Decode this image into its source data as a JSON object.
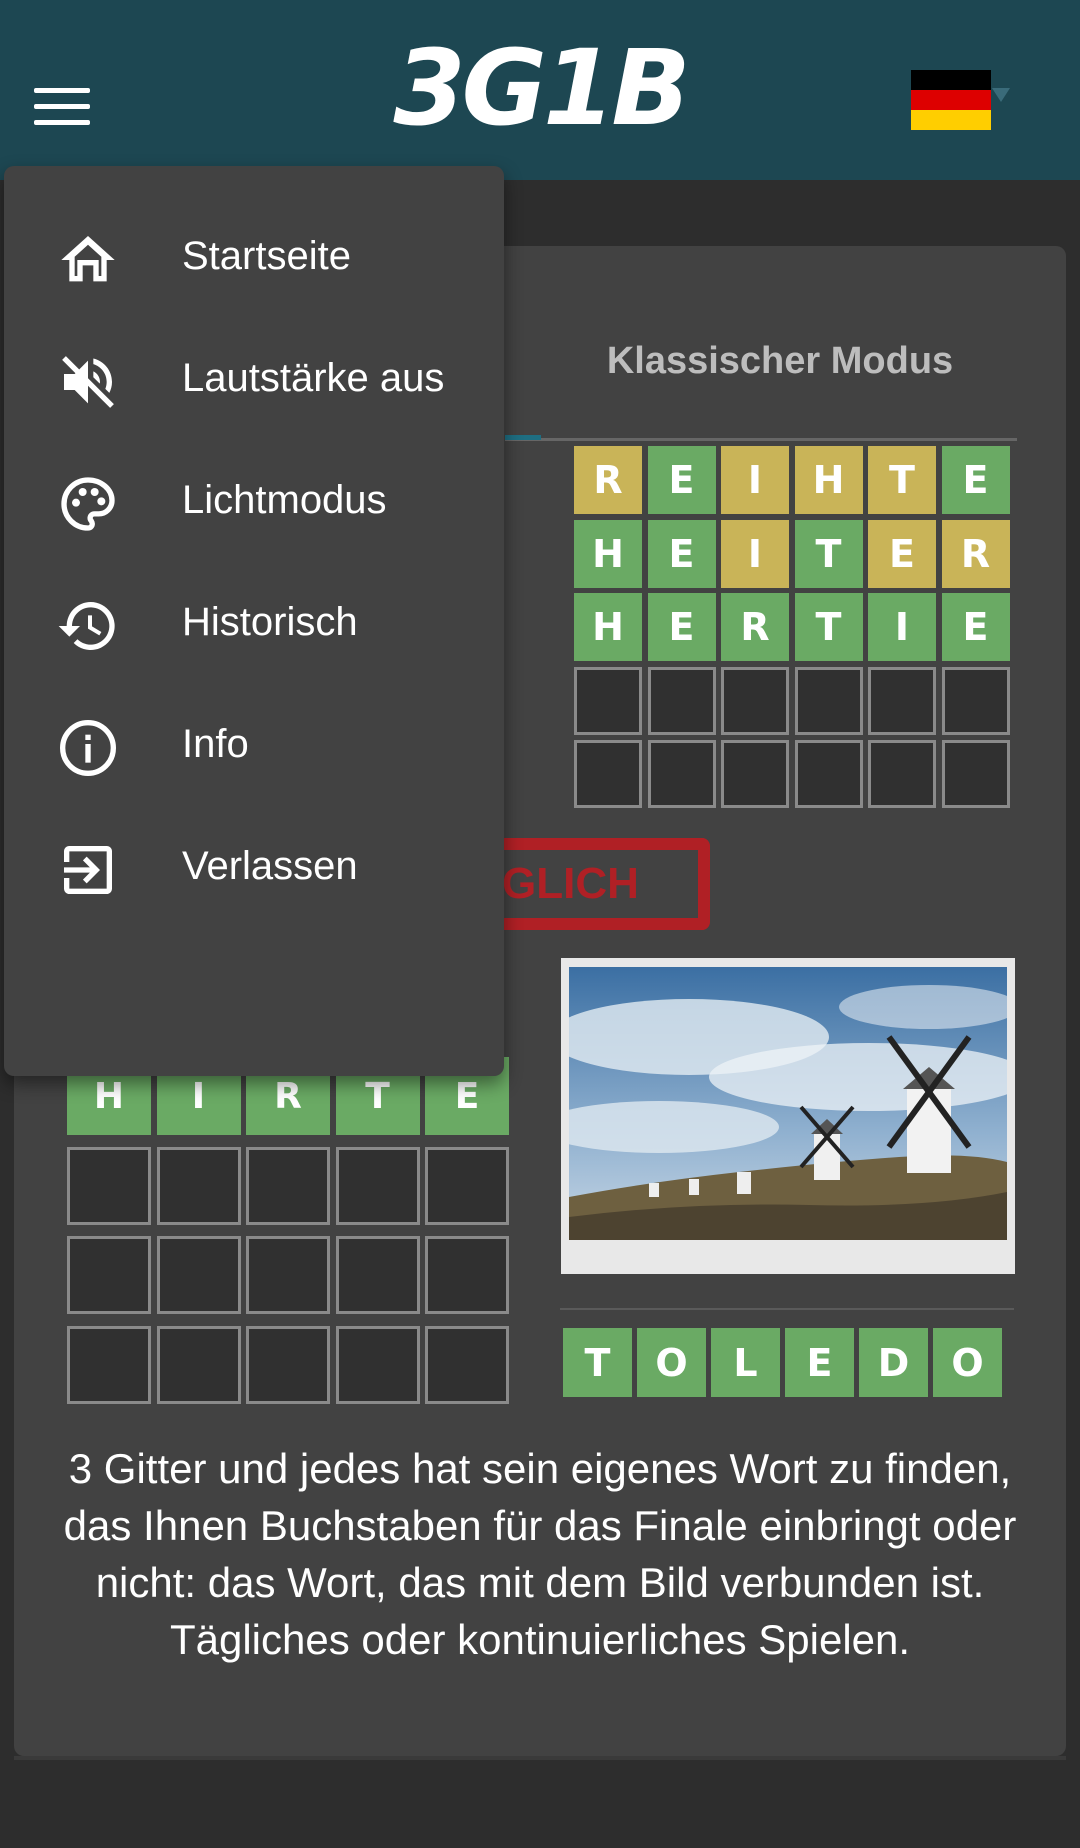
{
  "header": {
    "logo": "3G1B",
    "menu_icon": "hamburger-menu-icon",
    "language_flag": "germany-flag-icon"
  },
  "menu": {
    "items": [
      {
        "label": "Startseite",
        "icon": "home-icon"
      },
      {
        "label": "Lautstärke aus",
        "icon": "volume-off-icon"
      },
      {
        "label": "Lichtmodus",
        "icon": "palette-icon"
      },
      {
        "label": "Historisch",
        "icon": "history-icon"
      },
      {
        "label": "Info",
        "icon": "info-icon"
      },
      {
        "label": "Verlassen",
        "icon": "exit-icon"
      }
    ]
  },
  "main": {
    "tab_label": "Klassischer Modus",
    "grid_right": [
      [
        [
          "R",
          "y"
        ],
        [
          "E",
          "g"
        ],
        [
          "I",
          "y"
        ],
        [
          "H",
          "y"
        ],
        [
          "T",
          "y"
        ],
        [
          "E",
          "g"
        ]
      ],
      [
        [
          "H",
          "g"
        ],
        [
          "E",
          "g"
        ],
        [
          "I",
          "y"
        ],
        [
          "T",
          "g"
        ],
        [
          "E",
          "y"
        ],
        [
          "R",
          "y"
        ]
      ],
      [
        [
          "H",
          "g"
        ],
        [
          "E",
          "g"
        ],
        [
          "R",
          "g"
        ],
        [
          "T",
          "g"
        ],
        [
          "I",
          "g"
        ],
        [
          "E",
          "g"
        ]
      ],
      [
        [
          "",
          "e"
        ],
        [
          "",
          "e"
        ],
        [
          "",
          "e"
        ],
        [
          "",
          "e"
        ],
        [
          "",
          "e"
        ],
        [
          "",
          "e"
        ]
      ],
      [
        [
          "",
          "e"
        ],
        [
          "",
          "e"
        ],
        [
          "",
          "e"
        ],
        [
          "",
          "e"
        ],
        [
          "",
          "e"
        ],
        [
          "",
          "e"
        ]
      ]
    ],
    "grid_left": [
      [
        [
          "H",
          "g"
        ],
        [
          "I",
          "g"
        ],
        [
          "R",
          "g"
        ],
        [
          "T",
          "g"
        ],
        [
          "E",
          "g"
        ]
      ],
      [
        [
          "",
          "e"
        ],
        [
          "",
          "e"
        ],
        [
          "",
          "e"
        ],
        [
          "",
          "e"
        ],
        [
          "",
          "e"
        ]
      ],
      [
        [
          "",
          "e"
        ],
        [
          "",
          "e"
        ],
        [
          "",
          "e"
        ],
        [
          "",
          "e"
        ],
        [
          "",
          "e"
        ]
      ],
      [
        [
          "",
          "e"
        ],
        [
          "",
          "e"
        ],
        [
          "",
          "e"
        ],
        [
          "",
          "e"
        ],
        [
          "",
          "e"
        ]
      ]
    ],
    "stamp_text": "GLICH",
    "answer": [
      "T",
      "O",
      "L",
      "E",
      "D",
      "O"
    ],
    "description": "3 Gitter und jedes hat sein eigenes Wort zu finden, das Ihnen Buchstaben für das Finale einbringt oder nicht: das Wort, das mit dem Bild verbunden ist. Tägliches oder kontinuierliches Spielen."
  },
  "colors": {
    "header": "#1d4752",
    "green": "#6aaa64",
    "yellow": "#c9b458",
    "card": "#424242",
    "stamp": "#b02025"
  }
}
